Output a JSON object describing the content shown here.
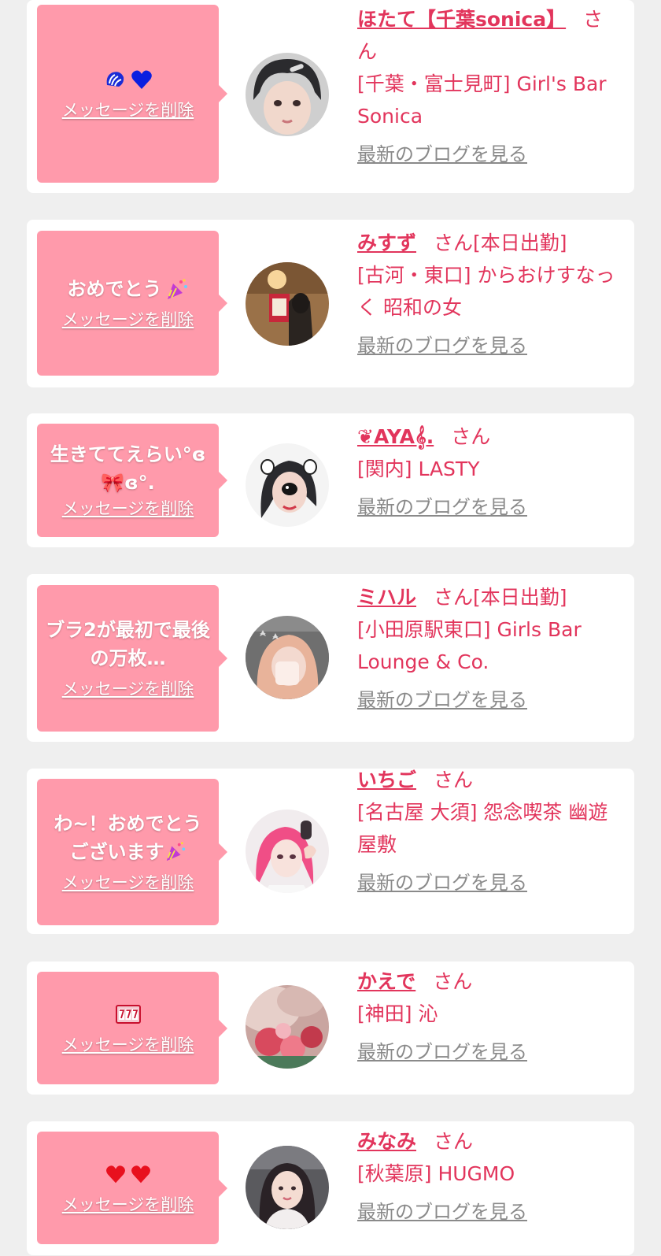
{
  "delete_label": "メッセージを削除",
  "blog_label": "最新のブログを見る",
  "san_label": "さん",
  "colors": {
    "accent": "#e2355c",
    "bubble": "#ff9aab",
    "background": "#efefef",
    "card": "#ffffff",
    "link_gray": "#8a8a8a"
  },
  "messages": [
    {
      "message": "",
      "emoji_icons": [
        "shell-icon",
        "blue-heart-icon"
      ],
      "name": "ほたて【千葉sonica】",
      "name_suffix": "",
      "shop": "[千葉・富士見町] Girl's Bar Sonica"
    },
    {
      "message": "おめでとう",
      "emoji_icons": [
        "party-popper-icon"
      ],
      "name": "みすず",
      "name_suffix": "[本日出勤]",
      "shop": "[古河・東口] からおけすなっく 昭和の女"
    },
    {
      "message": "生きててえらい°ɞ 🎀ɞ°.",
      "emoji_icons": [],
      "name": "❦AYA𝄞.",
      "name_suffix": "",
      "shop": "[関内] LASTY"
    },
    {
      "message": "ブラ2が最初で最後の万枚…",
      "emoji_icons": [],
      "name": "ミハル",
      "name_suffix": "[本日出勤]",
      "shop": "[小田原駅東口] Girls Bar Lounge & Co."
    },
    {
      "message": "わ~！おめでとうございます",
      "emoji_icons": [
        "party-popper-icon"
      ],
      "name": "いちご",
      "name_suffix": "",
      "shop": "[名古屋 大須] 怨念喫茶 幽遊屋敷"
    },
    {
      "message": "",
      "emoji_icons": [
        "slot-777-icon"
      ],
      "name": "かえで",
      "name_suffix": "",
      "shop": "[神田] 沁"
    },
    {
      "message": "",
      "emoji_icons": [
        "red-heart-icon",
        "red-heart-icon"
      ],
      "name": "みなみ",
      "name_suffix": "",
      "shop": "[秋葉原] HUGMO"
    }
  ]
}
